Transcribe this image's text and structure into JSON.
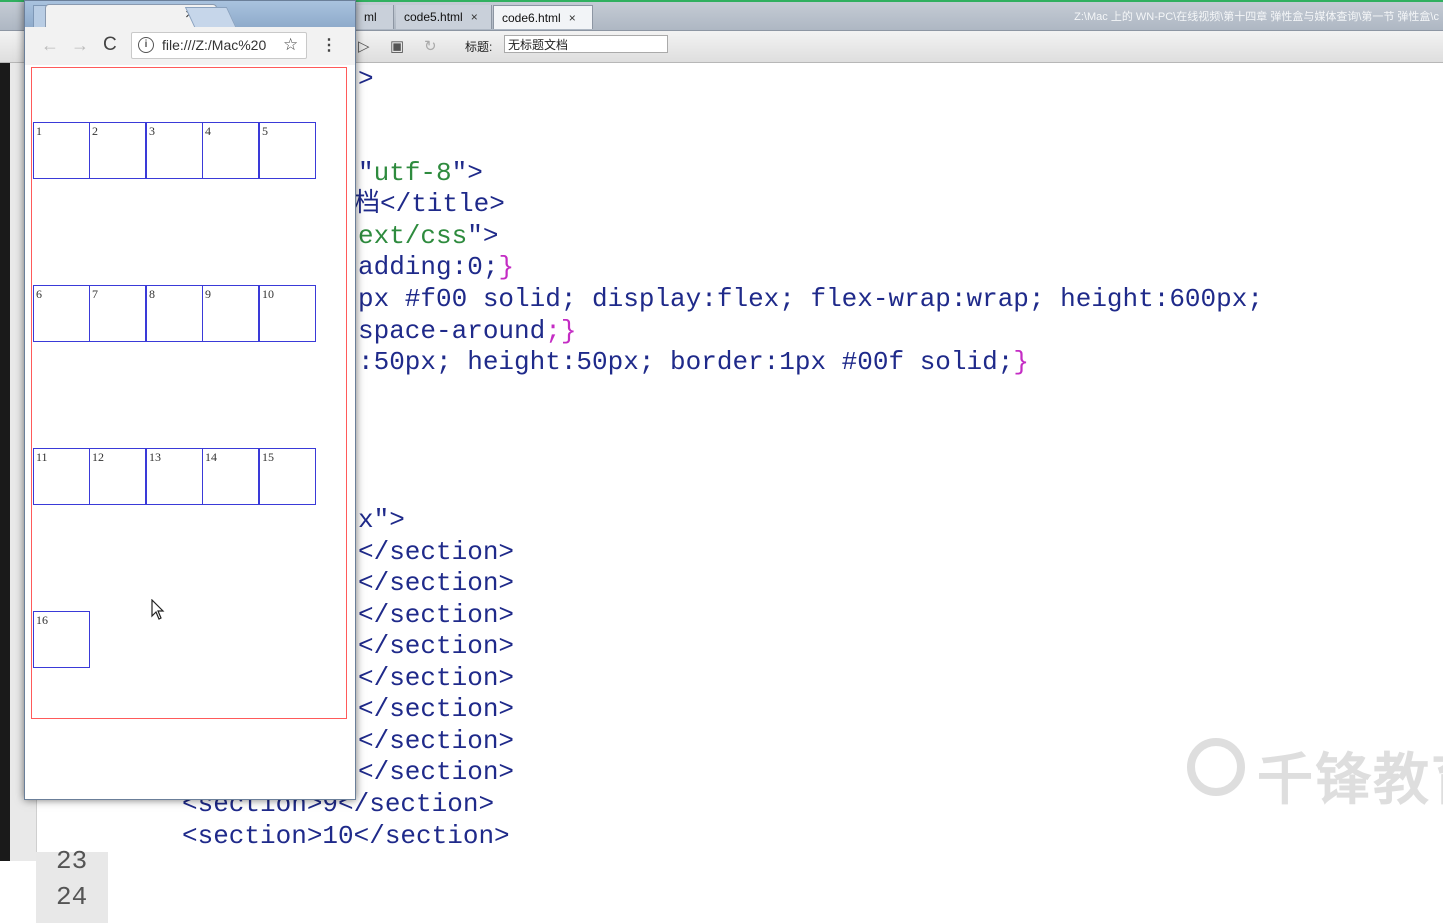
{
  "editor": {
    "tabs": [
      {
        "label": "ml",
        "close": "×"
      },
      {
        "label": "code5.html",
        "close": "×"
      },
      {
        "label": "code6.html",
        "close": "×"
      }
    ],
    "path": "Z:\\Mac 上的 WN-PC\\在线视频\\第十四章 弹性盒与媒体查询\\第一节 弹性盒\\c",
    "title_label": "标题:",
    "title_value": "无标题文档",
    "code": [
      {
        "text": ">"
      },
      {
        "text": "\"utf-8\">"
      },
      {
        "text": "档</title>"
      },
      {
        "text": "ext/css\">"
      },
      {
        "text": "adding:0;}"
      },
      {
        "text": "px #f00 solid; display:flex; flex-wrap:wrap; height:600px;"
      },
      {
        "text": "space-around;}"
      },
      {
        "text": ":50px; height:50px; border:1px #00f solid;}"
      },
      {
        "text": "x\">"
      },
      {
        "text": "</section>"
      },
      {
        "text": "</section>"
      },
      {
        "text": "</section>"
      },
      {
        "text": "</section>"
      },
      {
        "text": "</section>"
      },
      {
        "text": "</section>"
      },
      {
        "text": "</section>"
      },
      {
        "text": "</section>"
      },
      {
        "text": "<section>9</section>"
      },
      {
        "text": "<section>10</section>"
      }
    ],
    "line_numbers": [
      "23",
      "24"
    ],
    "watermark": "千锋教育"
  },
  "browser": {
    "tab_close": "×",
    "url": "file:///Z:/Mac%20",
    "info_icon": "i",
    "back_icon": "←",
    "forward_icon": "→",
    "reload_icon": "C",
    "star_icon": "☆",
    "menu_icon": "⋮",
    "sections": [
      "1",
      "2",
      "3",
      "4",
      "5",
      "6",
      "7",
      "8",
      "9",
      "10",
      "11",
      "12",
      "13",
      "14",
      "15",
      "16"
    ]
  },
  "colors": {
    "flex_border": "#ff0000",
    "item_border": "#0000ff",
    "code_green": "#2e8b3e",
    "code_navy": "#1f2a8a",
    "code_magenta": "#c42cc4"
  }
}
